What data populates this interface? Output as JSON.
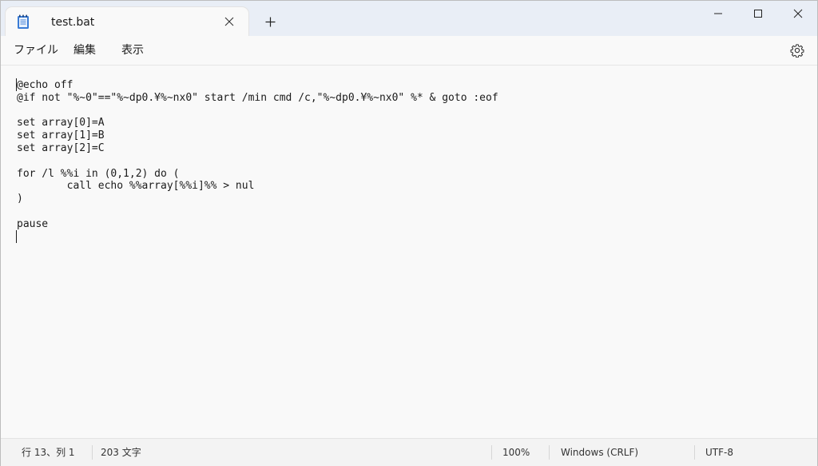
{
  "tab": {
    "title": "test.bat"
  },
  "menu": {
    "items": [
      "ファイル",
      "編集",
      "表示"
    ]
  },
  "editor": {
    "lines": [
      "@echo off",
      "@if not \"%~0\"==\"%~dp0.¥%~nx0\" start /min cmd /c,\"%~dp0.¥%~nx0\" %* & goto :eof",
      "",
      "set array[0]=A",
      "set array[1]=B",
      "set array[2]=C",
      "",
      "for /l %%i in (0,1,2) do (",
      "        call echo %%array[%%i]%% > nul",
      ")",
      "",
      "pause",
      ""
    ]
  },
  "status": {
    "position": "行 13、列 1",
    "char_count": "203 文字",
    "zoom": "100%",
    "line_ending": "Windows (CRLF)",
    "encoding": "UTF-8"
  },
  "icons": {
    "tab": "notepad-icon",
    "close": "close-icon",
    "new_tab": "plus-icon",
    "minimize": "minimize-icon",
    "maximize": "maximize-icon",
    "window_close": "close-icon",
    "settings": "gear-icon"
  }
}
